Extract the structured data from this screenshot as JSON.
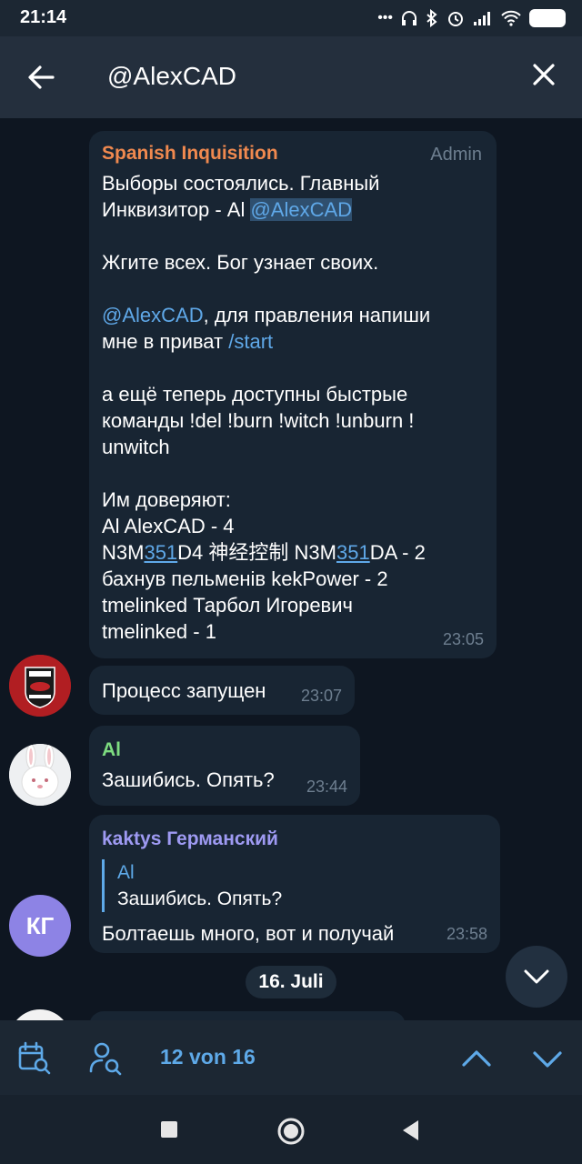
{
  "status": {
    "time": "21:14",
    "battery": "60"
  },
  "header": {
    "search_value": "@AlexCAD"
  },
  "messages": {
    "m1": {
      "sender": "Spanish Inquisition",
      "role": "Admin",
      "line1": "Выборы состоялись. Главный",
      "line2_text": "Инквизитор - Al ",
      "line2_mention": "@AlexCAD",
      "line3": "Жгите всех. Бог узнает своих.",
      "line4_mention": "@AlexCAD",
      "line4_text": ", для правления напиши",
      "line5_text": "мне в приват ",
      "line5_cmd": "/start",
      "line6": "а ещё теперь доступны быстрые",
      "line7": "команды !del !burn !witch !unburn !",
      "line8": "unwitch",
      "line9": "Им доверяют:",
      "line10": "Al   AlexCAD - 4",
      "line11_a": "N3M",
      "line11_b": "351",
      "line11_c": "D4 神经控制   N3M",
      "line11_d": "351",
      "line11_e": "DA - 2",
      "line12": "бахнув пельменів   kekPower - 2",
      "line13": "tmelinked Тарбол Игоревич",
      "line14": "tmelinked - 1",
      "time": "23:05"
    },
    "m2": {
      "text": "Процесс запущен",
      "time": "23:07"
    },
    "m3": {
      "sender": "Al",
      "text": "Зашибись. Опять?",
      "time": "23:44"
    },
    "m4": {
      "sender": "kaktys Германский",
      "reply_sender": "Al",
      "reply_text": "Зашибись. Опять?",
      "text": "Болтаешь много, вот и получай",
      "time": "23:58",
      "avatar_initials": "КГ"
    }
  },
  "date_chip": "16. Juli",
  "search_nav": {
    "counter": "12 von 16"
  },
  "colors": {
    "accent": "#5ea9e8",
    "admin_name": "#f0894f",
    "al_name": "#7ddc80",
    "kaktys_name": "#9e9af2",
    "avatar_kg": "#8d83e5"
  }
}
